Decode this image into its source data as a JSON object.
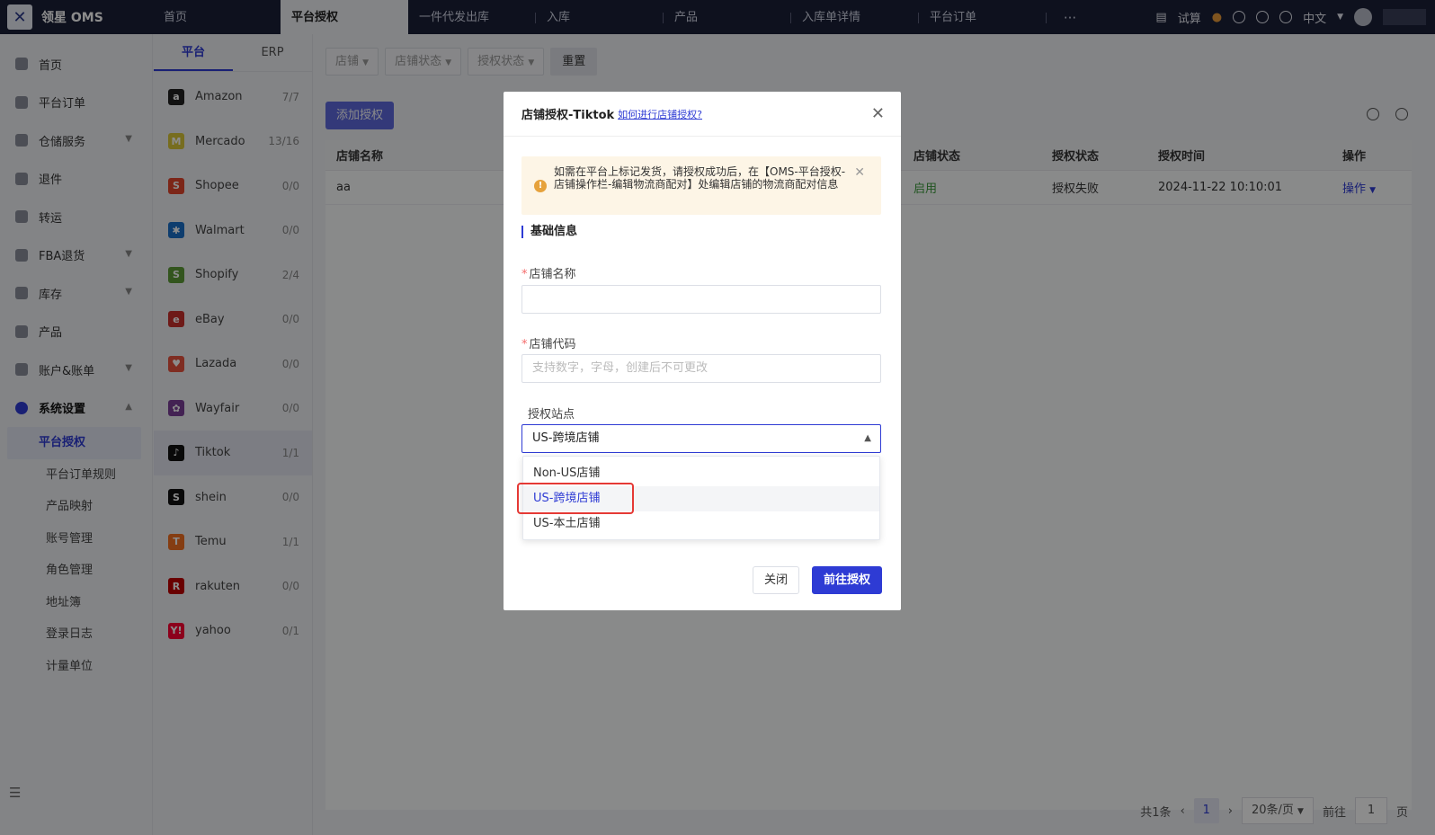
{
  "app": {
    "name": "领星 OMS"
  },
  "topnav": {
    "tabs": [
      "首页",
      "平台授权",
      "一件代发出库",
      "入库",
      "产品",
      "入库单详情",
      "平台订单"
    ],
    "more": "···",
    "trial": "试算",
    "language": "中文"
  },
  "sidebar": {
    "items": [
      "首页",
      "平台订单",
      "仓储服务",
      "退件",
      "转运",
      "FBA退货",
      "库存",
      "产品",
      "账户&账单",
      "系统设置"
    ],
    "sub_items": [
      "平台授权",
      "平台订单规则",
      "产品映射",
      "账号管理",
      "角色管理",
      "地址簿",
      "登录日志",
      "计量单位"
    ],
    "collapse_icon": "menu-collapse-icon"
  },
  "platform_panel": {
    "tabs": [
      "平台",
      "ERP"
    ],
    "platforms": [
      {
        "name": "Amazon",
        "count": "7/7",
        "color": "#222222",
        "glyph": "a"
      },
      {
        "name": "Mercado",
        "count": "13/16",
        "color": "#d9c63a",
        "glyph": "M"
      },
      {
        "name": "Shopee",
        "count": "0/0",
        "color": "#e2452d",
        "glyph": "S"
      },
      {
        "name": "Walmart",
        "count": "0/0",
        "color": "#1a6fc9",
        "glyph": "✱"
      },
      {
        "name": "Shopify",
        "count": "2/4",
        "color": "#5e9c38",
        "glyph": "S"
      },
      {
        "name": "eBay",
        "count": "0/0",
        "color": "#c9302c",
        "glyph": "e"
      },
      {
        "name": "Lazada",
        "count": "0/0",
        "color": "#e8533e",
        "glyph": "♥"
      },
      {
        "name": "Wayfair",
        "count": "0/0",
        "color": "#7b3f98",
        "glyph": "✿"
      },
      {
        "name": "Tiktok",
        "count": "1/1",
        "color": "#111111",
        "glyph": "♪"
      },
      {
        "name": "shein",
        "count": "0/0",
        "color": "#111111",
        "glyph": "S"
      },
      {
        "name": "Temu",
        "count": "1/1",
        "color": "#f27022",
        "glyph": "T"
      },
      {
        "name": "rakuten",
        "count": "0/0",
        "color": "#bf0000",
        "glyph": "R"
      },
      {
        "name": "yahoo",
        "count": "0/1",
        "color": "#ff0033",
        "glyph": "Y!"
      }
    ]
  },
  "filters": {
    "shop": "店铺",
    "shop_status": "店铺状态",
    "auth_status": "授权状态",
    "reset": "重置"
  },
  "add_button": "添加授权",
  "table": {
    "headers": [
      "店铺名称",
      "店铺状态",
      "授权状态",
      "授权时间",
      "操作"
    ],
    "rows": [
      [
        "aa",
        "启用",
        "授权失败",
        "2024-11-22 10:10:01",
        "操作"
      ]
    ]
  },
  "pagination": {
    "total": "共1条",
    "current": "1",
    "page_size": "20条/页",
    "goto": "前往",
    "goto_value": "1",
    "page_unit": "页"
  },
  "modal": {
    "title": "店铺授权-Tiktok",
    "help_link": "如何进行店铺授权?",
    "alert": "如需在平台上标记发货，请授权成功后，在【OMS-平台授权-店铺操作栏-编辑物流商配对】处编辑店铺的物流商配对信息",
    "section": "基础信息",
    "shop_name_label": "店铺名称",
    "shop_code_label": "店铺代码",
    "shop_code_placeholder": "支持数字，字母，创建后不可更改",
    "site_label": "授权站点",
    "site_value": "US-跨境店铺",
    "site_options": [
      "Non-US店铺",
      "US-跨境店铺",
      "US-本土店铺"
    ],
    "close_button": "关闭",
    "submit_button": "前往授权"
  },
  "colors": {
    "primary": "#2e3bd4",
    "topbar": "#1a1f38",
    "success": "#3a9a3a",
    "highlight": "#e53935"
  }
}
